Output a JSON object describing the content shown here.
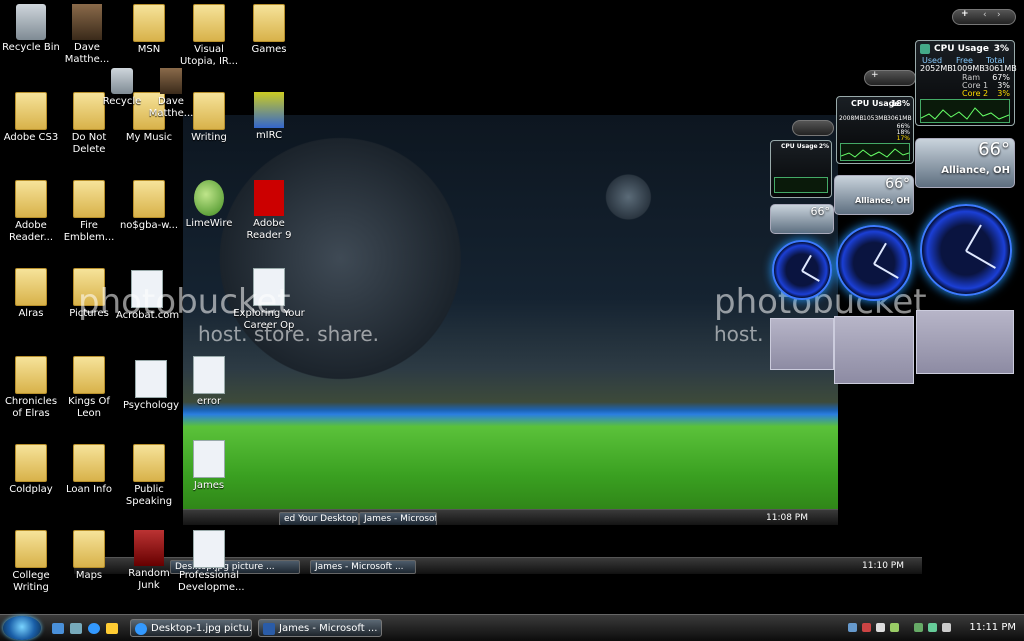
{
  "desktop_icons": {
    "recycle_bin": "Recycle Bin",
    "dave": "Dave Matthe...",
    "msn": "MSN",
    "visual_utopia": "Visual Utopia, IR...",
    "games": "Games",
    "adobe_cs3": "Adobe CS3",
    "do_not_delete": "Do Not Delete",
    "adobe_reader": "Adobe Reader...",
    "fire_emblem": "Fire Emblem...",
    "alras": "Alras",
    "pictures": "Pictures",
    "chronicles": "Chronicles of Elras",
    "kings_of_leon": "Kings Of Leon",
    "coldplay": "Coldplay",
    "loan_info": "Loan Info",
    "college_writing": "College Writing",
    "maps": "Maps",
    "public_speaking": "Public Speaking",
    "random_junk": "Random Junk",
    "professional_dev": "Professional Developme...",
    "james": "James",
    "psychology": "Psychology",
    "acrobat": "Acrobat.com",
    "error": "error",
    "my_music": "My Music",
    "writing": "Writing",
    "mirc": "mIRC",
    "limewire": "LimeWire",
    "nosgba": "no$gba-w...",
    "adobe_reader9": "Adobe Reader 9",
    "exploring_career": "Exploring Your Career Op",
    "recycle": "Recycle",
    "dave2": "Dave Matthe..."
  },
  "watermark": {
    "brand": "photobucket",
    "tagline": "host. store. share."
  },
  "gadgets": {
    "cpu_large": {
      "title": "CPU Usage",
      "percent": "3%",
      "used_label": "Used",
      "free_label": "Free",
      "total_label": "Total",
      "used": "2052MB",
      "free": "1009MB",
      "total": "3061MB",
      "ram_label": "Ram",
      "ram": "67%",
      "core1_label": "Core 1",
      "core1": "3%",
      "core2_label": "Core 2",
      "core2": "3%"
    },
    "cpu_mid": {
      "title": "CPU Usage",
      "percent": "18%",
      "used": "2008MB",
      "free": "1053MB",
      "total": "3061MB",
      "ram": "66%",
      "core1": "18%",
      "core2": "17%"
    },
    "cpu_small": {
      "title": "CPU Usage",
      "percent": "2%"
    },
    "weather": {
      "temp": "66°",
      "location": "Alliance, OH"
    }
  },
  "taskbar": {
    "tasks": [
      {
        "label": "Desktop-1.jpg pictu..."
      },
      {
        "label": "James - Microsoft ..."
      }
    ],
    "clock": "11:11 PM",
    "inner_clock": "11:10 PM",
    "inner2_clock": "11:08 PM",
    "inner_tasks": [
      {
        "label": "Desktop.jpg picture ..."
      },
      {
        "label": "James - Microsoft ..."
      }
    ],
    "inner2_tasks": [
      {
        "label": "ed Your Desktop ..."
      },
      {
        "label": "James - Microsoft ..."
      }
    ]
  },
  "colors": {
    "accent": "#1b3fd6",
    "grass": "#3aa021",
    "taskbar": "#1a1a1a"
  }
}
